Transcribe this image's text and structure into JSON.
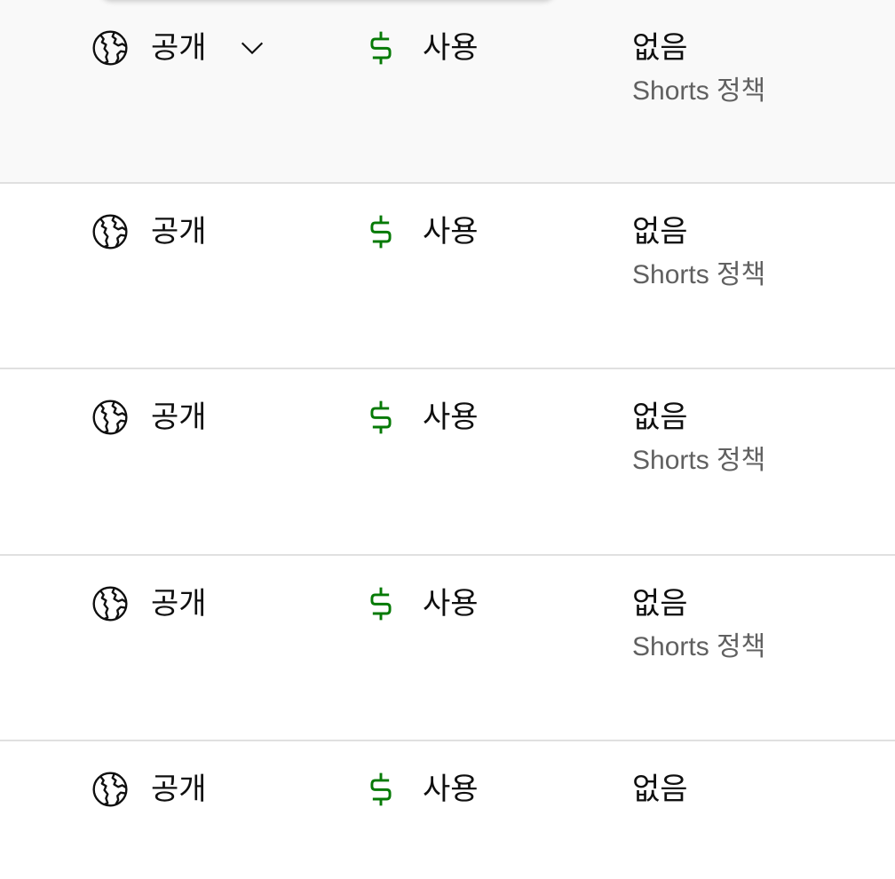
{
  "rows": [
    {
      "visibility": {
        "icon": "globe-icon",
        "label": "공개",
        "dropdown": "chevron-down-icon"
      },
      "monetization": {
        "icon": "dollar-icon",
        "label": "사용",
        "color": "#067a06"
      },
      "restrictions": {
        "label": "없음",
        "policy": "Shorts 정책"
      }
    },
    {
      "visibility": {
        "icon": "globe-icon",
        "label": "공개"
      },
      "monetization": {
        "icon": "dollar-icon",
        "label": "사용",
        "color": "#067a06"
      },
      "restrictions": {
        "label": "없음",
        "policy": "Shorts 정책"
      }
    },
    {
      "visibility": {
        "icon": "globe-icon",
        "label": "공개"
      },
      "monetization": {
        "icon": "dollar-icon",
        "label": "사용",
        "color": "#067a06"
      },
      "restrictions": {
        "label": "없음",
        "policy": "Shorts 정책"
      }
    },
    {
      "visibility": {
        "icon": "globe-icon",
        "label": "공개"
      },
      "monetization": {
        "icon": "dollar-icon",
        "label": "사용",
        "color": "#067a06"
      },
      "restrictions": {
        "label": "없음",
        "policy": "Shorts 정책"
      }
    },
    {
      "visibility": {
        "icon": "globe-icon",
        "label": "공개"
      },
      "monetization": {
        "icon": "dollar-icon",
        "label": "사용",
        "color": "#067a06"
      },
      "restrictions": {
        "label": "없음"
      }
    }
  ],
  "colors": {
    "text_primary": "#0f0f0f",
    "text_secondary": "#606060",
    "monetization_on": "#067a06",
    "row_divider": "#e0e0e0",
    "row_hover_bg": "#f9f9f9"
  }
}
